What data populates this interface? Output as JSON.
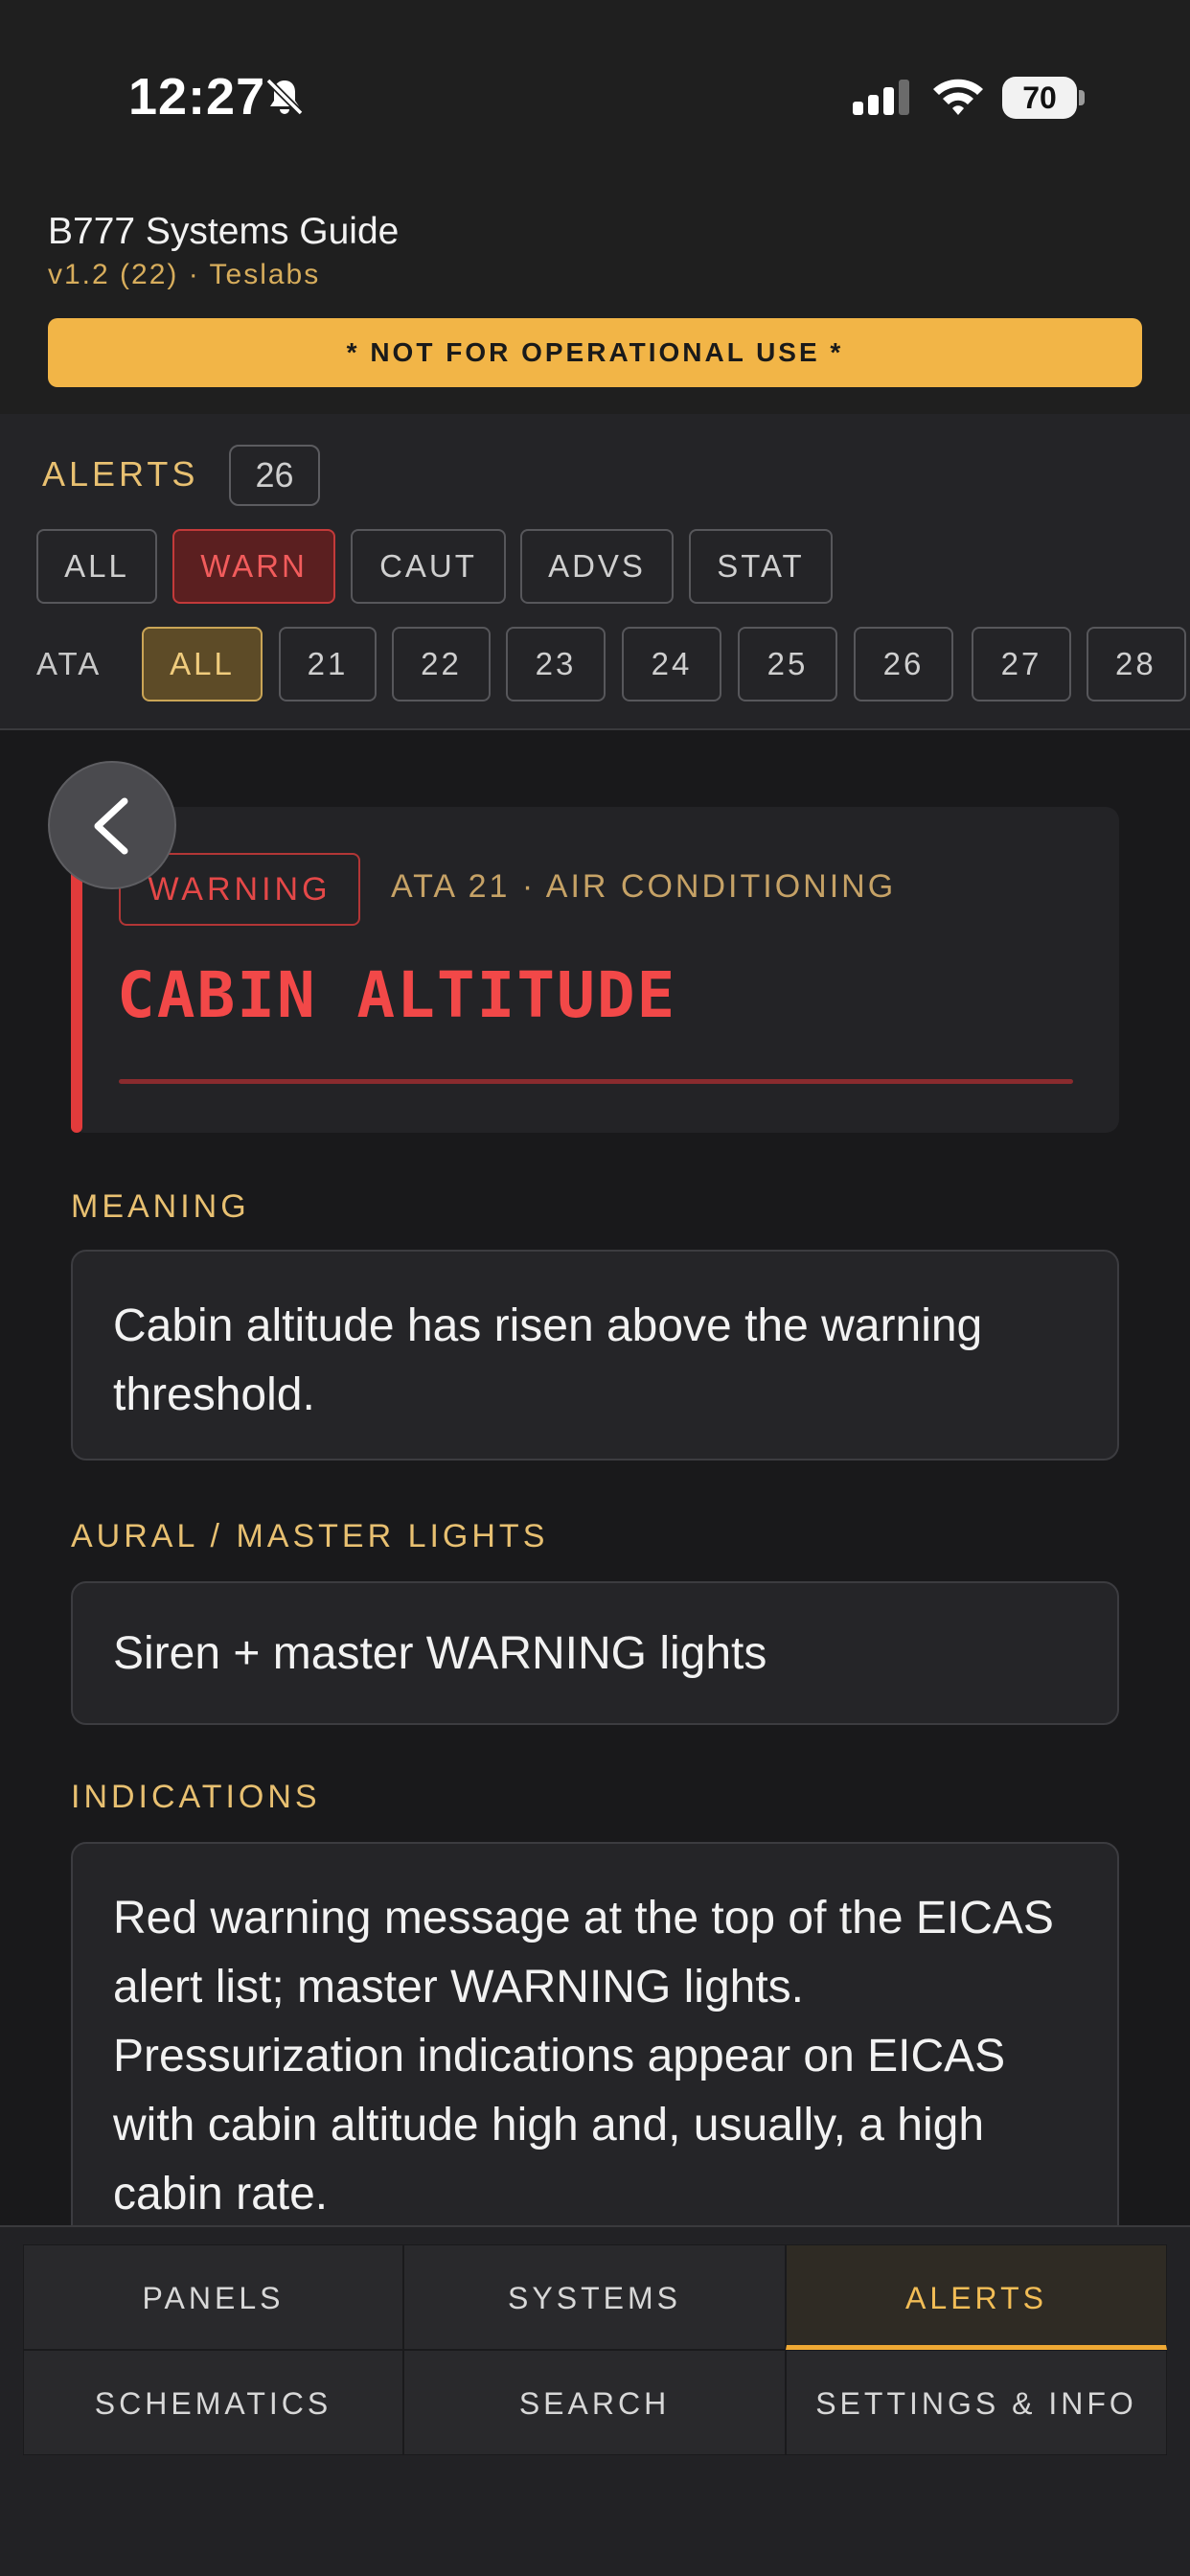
{
  "status_bar": {
    "time": "12:27",
    "battery": "70"
  },
  "app": {
    "title": "B777 Systems Guide",
    "version": "v1.2 (22) · Teslabs",
    "banner": "* NOT FOR OPERATIONAL USE *"
  },
  "filters": {
    "alerts_label": "ALERTS",
    "alerts_count": "26",
    "level_chips": [
      {
        "label": "ALL",
        "active": false
      },
      {
        "label": "WARN",
        "active": true
      },
      {
        "label": "CAUT",
        "active": false
      },
      {
        "label": "ADVS",
        "active": false
      },
      {
        "label": "STAT",
        "active": false
      }
    ],
    "ata_label": "ATA",
    "ata_chips": [
      {
        "label": "ALL",
        "active": true
      },
      {
        "label": "21"
      },
      {
        "label": "22"
      },
      {
        "label": "23"
      },
      {
        "label": "24"
      },
      {
        "label": "25"
      },
      {
        "label": "26"
      },
      {
        "label": "27"
      },
      {
        "label": "28"
      }
    ]
  },
  "alert": {
    "level_tag": "WARNING",
    "ata_system": "ATA 21 · AIR CONDITIONING",
    "title": "CABIN ALTITUDE",
    "accent_color": "#e23b3b"
  },
  "sections": {
    "meaning": {
      "label": "MEANING",
      "text": "Cabin altitude has risen above the warning threshold."
    },
    "aural": {
      "label": "AURAL / MASTER LIGHTS",
      "text": "Siren + master WARNING lights"
    },
    "indications": {
      "label": "INDICATIONS",
      "text": "Red warning message at the top of the EICAS alert list; master WARNING lights. Pressurization indications appear on EICAS with cabin altitude high and, usually, a high cabin rate."
    }
  },
  "tabs": [
    {
      "label": "PANELS",
      "active": false
    },
    {
      "label": "SYSTEMS",
      "active": false
    },
    {
      "label": "ALERTS",
      "active": true
    },
    {
      "label": "SCHEMATICS",
      "active": false
    },
    {
      "label": "SEARCH",
      "active": false
    },
    {
      "label": "SETTINGS & INFO",
      "active": false
    }
  ],
  "icons": [
    "bell-slash-icon",
    "cellular-signal-icon",
    "wifi-icon",
    "battery-icon",
    "chevron-left-icon"
  ]
}
